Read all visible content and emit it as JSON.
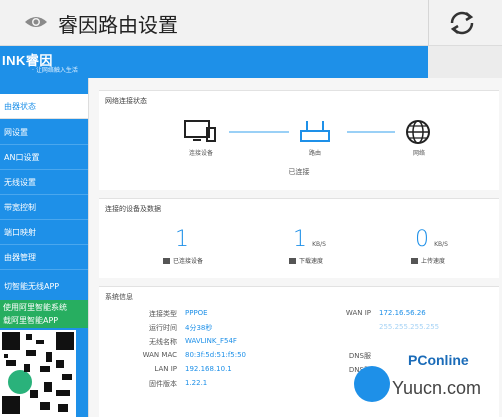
{
  "topbar": {
    "title": "睿因路由设置",
    "eye_icon": "eye-icon",
    "refresh_icon": "refresh-icon"
  },
  "header": {
    "logo": "INK睿因",
    "slogan": "· 让网络触入生活"
  },
  "sidebar": {
    "items": [
      {
        "label": "由器状态",
        "active": true
      },
      {
        "label": "网设置"
      },
      {
        "label": "AN口设置"
      },
      {
        "label": "无线设置"
      },
      {
        "label": "带宽控制"
      },
      {
        "label": "端口映射"
      },
      {
        "label": "由器管理"
      }
    ],
    "app_item": "切智能无线APP",
    "promo_line1": "使用阿里智能系统",
    "promo_line2": "载阿里智能APP"
  },
  "network_status": {
    "title": "网络连接状态",
    "devices": [
      "连接设备",
      "路由",
      "网络"
    ],
    "state": "已连接"
  },
  "device_stats": {
    "title": "连接的设备及数据",
    "items": [
      {
        "value": "1",
        "unit": "",
        "label": "已连接设备"
      },
      {
        "value": "1",
        "unit": "KB/S",
        "label": "下载速度"
      },
      {
        "value": "0",
        "unit": "KB/S",
        "label": "上传速度"
      }
    ]
  },
  "system_info": {
    "title": "系统信息",
    "left": [
      {
        "key": "连接类型",
        "value": "PPPOE"
      },
      {
        "key": "运行时间",
        "value": "4分38秒"
      },
      {
        "key": "无线名称",
        "value": "WAVLINK_F54F"
      },
      {
        "key": "WAN MAC",
        "value": "80:3f:5d:51:f5:50"
      },
      {
        "key": "LAN IP",
        "value": "192.168.10.1"
      },
      {
        "key": "固件版本",
        "value": "1.22.1"
      }
    ],
    "right": [
      {
        "key": "WAN IP",
        "value": "172.16.56.26"
      },
      {
        "key": "",
        "value": "255.255.255.255"
      },
      {
        "key": "DNS服",
        "value": ""
      },
      {
        "key": "DNS服",
        "value": ""
      }
    ]
  },
  "watermark": {
    "brand": "PConline",
    "site": "Yuucn.com"
  }
}
